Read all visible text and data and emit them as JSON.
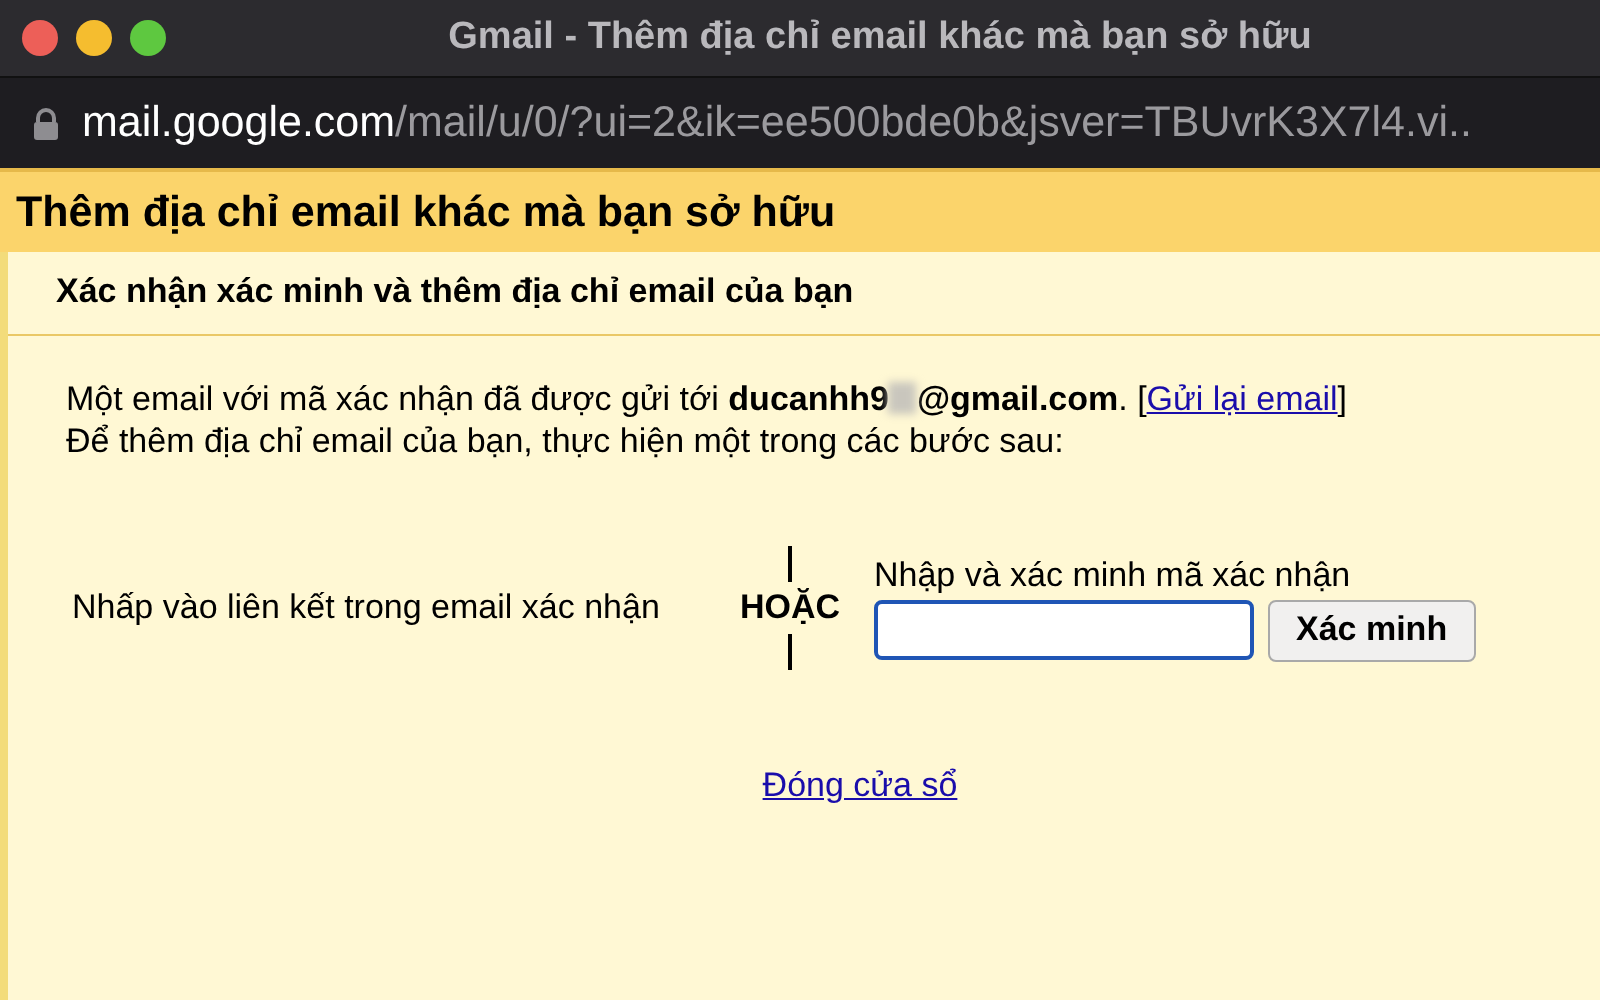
{
  "window": {
    "title": "Gmail - Thêm địa chỉ email khác mà bạn sở hữu"
  },
  "address_bar": {
    "host": "mail.google.com",
    "path": "/mail/u/0/?ui=2&ik=ee500bde0b&jsver=TBUvrK3X7l4.vi.."
  },
  "dialog": {
    "title": "Thêm địa chỉ email khác mà bạn sở hữu",
    "subtitle": "Xác nhận xác minh và thêm địa chỉ email của bạn",
    "notice": {
      "before": "Một email với mã xác nhận đã được gửi tới **ducanhh9**",
      "redacted": true,
      "after": "**@gmail.com**. [",
      "link": "Gửi lại email",
      "end": "]"
    },
    "instruction": "Để thêm địa chỉ email của bạn, thực hiện một trong các bước sau:",
    "option_link": "Nhấp vào liên kết trong email xác nhận",
    "divider_label": "HOẶC",
    "code_label": "Nhập và xác minh mã xác nhận",
    "code_field": {
      "focused": true
    },
    "verify_button": "Xác minh",
    "close_link": "Đóng cửa sổ"
  }
}
